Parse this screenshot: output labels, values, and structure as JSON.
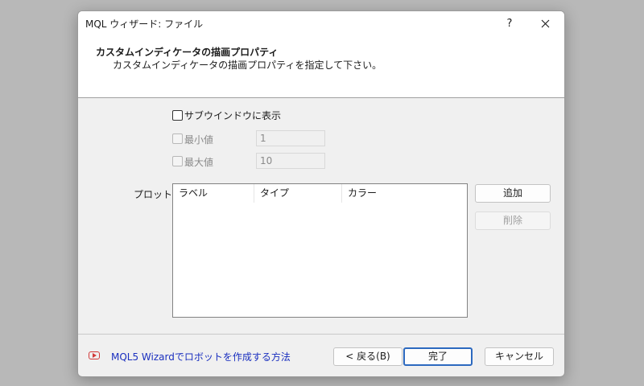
{
  "window": {
    "title": "MQL ウィザード: ファイル",
    "help_label": "?",
    "close_label": "✕"
  },
  "header": {
    "title": "カスタムインディケータの描画プロパティ",
    "subtitle": "カスタムインディケータの描画プロパティを指定して下さい。"
  },
  "options": {
    "subwindow_label": "サブウインドウに表示",
    "min_label": "最小値",
    "min_value": "1",
    "max_label": "最大値",
    "max_value": "10"
  },
  "plots": {
    "label": "プロット:",
    "columns": [
      "ラベル",
      "タイプ",
      "カラー"
    ],
    "add_label": "追加",
    "delete_label": "削除"
  },
  "footer": {
    "help_link": "MQL5 Wizardでロボットを作成する方法",
    "back_label": "< 戻る(B)",
    "finish_label": "完了",
    "cancel_label": "キャンセル"
  },
  "icons": {
    "video": "play-video-icon",
    "close": "close-icon"
  },
  "colors": {
    "link": "#1a2fbf",
    "primary_border": "#2c69bf",
    "video_icon": "#d23a3a"
  }
}
